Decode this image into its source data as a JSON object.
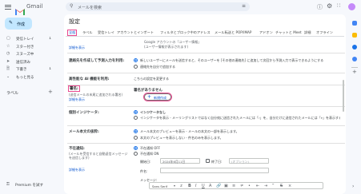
{
  "app": {
    "name": "Gmail",
    "brand_color": "#ea4335",
    "accent": "#1a73e8",
    "highlight": "#e8498f"
  },
  "header": {
    "search_placeholder": "メールを検索"
  },
  "sidebar": {
    "compose_label": "作成",
    "items": [
      {
        "label": "受信トレイ",
        "count": "1",
        "icon": "inbox-icon"
      },
      {
        "label": "スター付き",
        "icon": "star-icon"
      },
      {
        "label": "スヌーズ中",
        "icon": "clock-icon"
      },
      {
        "label": "送信済み",
        "icon": "send-icon"
      },
      {
        "label": "下書き",
        "count": "1",
        "icon": "draft-icon"
      },
      {
        "label": "もっと見る",
        "icon": "chevron-down-icon"
      }
    ],
    "labels_heading": "ラベル",
    "premium_label": "Premium を試す"
  },
  "settings": {
    "title": "設定",
    "tabs": [
      "全般",
      "ラベル",
      "受信トレイ",
      "アカウントとインポート",
      "フィルタとブロック中のアドレス",
      "メール転送と POP/IMAP",
      "アドオン",
      "チャットと Meet",
      "詳細",
      "オフライン"
    ],
    "rows": {
      "top_link": "詳細を表示",
      "top_text": "(ユーザー情報が表示されます)",
      "top_text2": "Google アカウントの「ユーザー情報」",
      "contacts_label": "連絡先を作成して予測入力を利用:",
      "contacts_opt1": "新しいユーザーにメールを送信すると、そのユーザーを [その他の連絡先] に追加して次回から予測入力で表示できるようにする",
      "contacts_opt2": "連絡先を自分で追加する",
      "ai_label": "高性能な AI 機能を利用:",
      "ai_text": "こちらの設定を変更する",
      "sig_label": "署名:",
      "sig_desc": "(送信メールの末尾に追加される署名)",
      "sig_link": "詳細を表示",
      "sig_empty": "署名がありません",
      "sig_new": "新規作成",
      "indicator_label": "個別インジケータ:",
      "indicator_opt1": "インジケータなし",
      "indicator_opt2": "インジケータを表示 - メーリングリストではなく自分宛に送信されたメールには「›」を、自分だけに送信されたメールには「»」を表示する",
      "snippet_label": "メール本文の抜粋:",
      "snippet_opt1": "メール本文のプレビューを表示 - メールの本文の一部を表示します。",
      "snippet_opt2": "本文のプレビューを表示しない - 件名のみを表示します。",
      "vacation_label": "不在通知:",
      "vacation_desc": "(メールを受信すると自動返信メッセージを送信します)",
      "vacation_link": "詳細を表示",
      "vacation_off": "不在通知 OFF",
      "vacation_on": "不在通知 ON",
      "start_label": "開始日:",
      "start_value": "2024年6月11日",
      "end_label": "終了日:",
      "end_value": "(オプション)",
      "subject_label": "件名:",
      "message_label": "メッセージ:",
      "font_name": "Sans Serif"
    }
  }
}
